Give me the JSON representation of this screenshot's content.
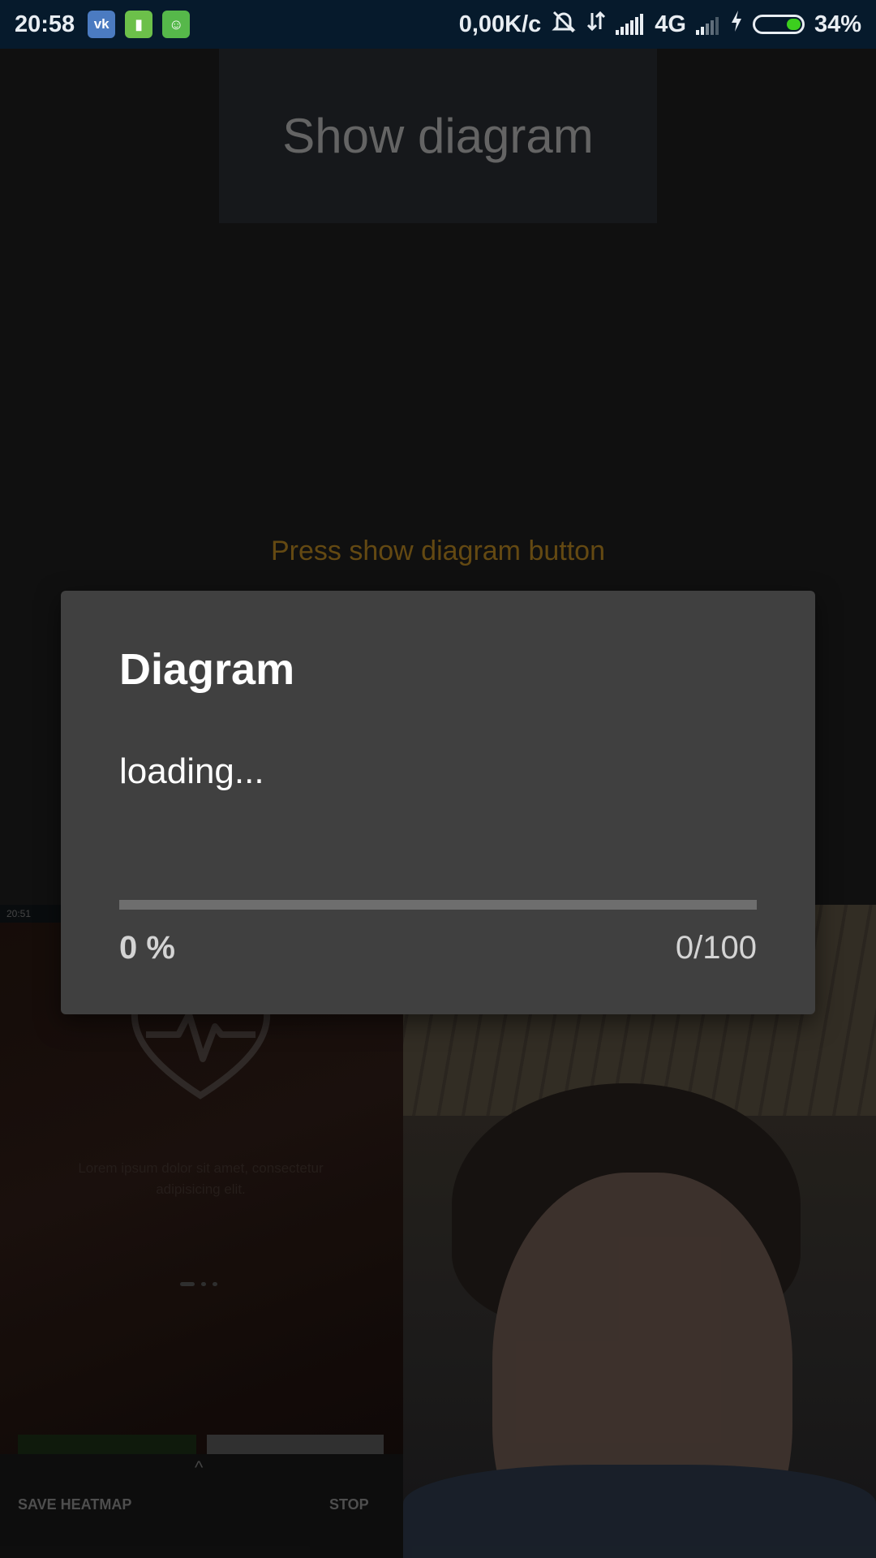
{
  "status_bar": {
    "time": "20:58",
    "speed": "0,00K/c",
    "network": "4G",
    "battery": "34%",
    "battery_level": 0.34,
    "icons": [
      "vk-icon",
      "battery-app-icon",
      "android-cat-icon",
      "alarm-off-icon",
      "data-arrows-icon",
      "signal-icon",
      "signal-icon-2",
      "charging-icon",
      "battery-icon"
    ]
  },
  "app": {
    "show_button_label": "Show diagram",
    "hint_text": "Press show diagram button"
  },
  "background_preview": {
    "status_time": "20:51",
    "lorem": "Lorem ipsum dolor sit amet, consectetur adipisicing elit.",
    "save_heatmap_label": "SAVE HEATMAP",
    "stop_label": "STOP"
  },
  "dialog": {
    "title": "Diagram",
    "message": "loading...",
    "progress_percent_label": "0 %",
    "progress_count_label": "0/100",
    "progress_value": 0,
    "progress_max": 100
  },
  "colors": {
    "status_bar_bg": "#061a2c",
    "hint_color": "#7a5a16",
    "dialog_bg": "#404040",
    "battery_fill": "#3ccf1e"
  }
}
